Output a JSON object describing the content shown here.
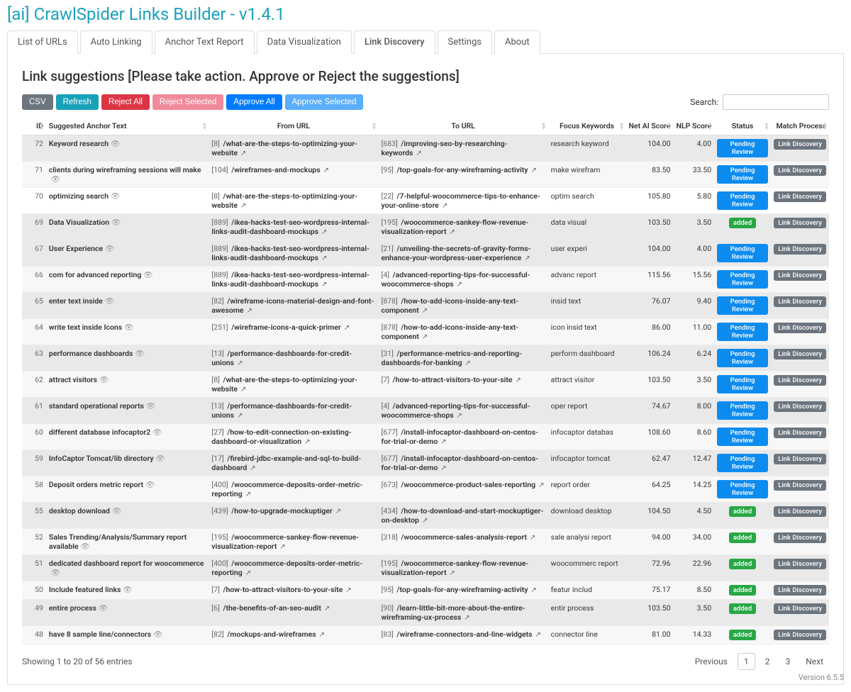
{
  "app": {
    "title": "[ai] CrawlSpider Links Builder - v1.4.1",
    "version": "Version 6.5.5"
  },
  "tabs": [
    {
      "label": "List of URLs"
    },
    {
      "label": "Auto Linking"
    },
    {
      "label": "Anchor Text Report"
    },
    {
      "label": "Data Visualization"
    },
    {
      "label": "Link Discovery"
    },
    {
      "label": "Settings"
    },
    {
      "label": "About"
    }
  ],
  "active_tab": 4,
  "section": {
    "title": "Link suggestions [Please take action. Approve or Reject the suggestions]"
  },
  "actions": {
    "csv": "CSV",
    "refresh": "Refresh",
    "reject_all": "Reject All",
    "reject_selected": "Reject Selected",
    "approve_all": "Approve All",
    "approve_selected": "Approve Selected"
  },
  "search": {
    "label": "Search:",
    "value": ""
  },
  "columns": {
    "id": "ID",
    "anchor": "Suggested Anchor Text",
    "from": "From URL",
    "to": "To URL",
    "focus": "Focus Keywords",
    "net": "Net AI Score",
    "nlp": "NLP Score",
    "status": "Status",
    "match": "Match Process"
  },
  "status_labels": {
    "pending": "Pending Review",
    "added": "added"
  },
  "match_label": "Link Discovery",
  "rows": [
    {
      "id": "72",
      "anchor": "Keyword research",
      "from_n": "[8]",
      "from_p": "/what-are-the-steps-to-optimizing-your-website",
      "to_n": "[683]",
      "to_p": "/improving-seo-by-researching-keywords",
      "kw": "research keyword",
      "net": "104.00",
      "nlp": "4.00",
      "status": "pending",
      "hl": true
    },
    {
      "id": "71",
      "anchor": "clients during wireframing sessions will make",
      "from_n": "[104]",
      "from_p": "/wireframes-and-mockups",
      "to_n": "[95]",
      "to_p": "/top-goals-for-any-wireframing-activity",
      "kw": "make wirefram",
      "net": "83.50",
      "nlp": "33.50",
      "status": "pending"
    },
    {
      "id": "70",
      "anchor": "optimizing search",
      "from_n": "[8]",
      "from_p": "/what-are-the-steps-to-optimizing-your-website",
      "to_n": "[22]",
      "to_p": "/7-helpful-woocommerce-tips-to-enhance-your-online-store",
      "kw": "optim search",
      "net": "105.80",
      "nlp": "5.80",
      "status": "pending"
    },
    {
      "id": "69",
      "anchor": "Data Visualization",
      "from_n": "[889]",
      "from_p": "/ikea-hacks-test-seo-wordpress-internal-links-audit-dashboard-mockups",
      "to_n": "[195]",
      "to_p": "/woocommerce-sankey-flow-revenue-visualization-report",
      "kw": "data visual",
      "net": "103.50",
      "nlp": "3.50",
      "status": "added",
      "hl": true
    },
    {
      "id": "67",
      "anchor": "User Experience",
      "from_n": "[889]",
      "from_p": "/ikea-hacks-test-seo-wordpress-internal-links-audit-dashboard-mockups",
      "to_n": "[21]",
      "to_p": "/unveiling-the-secrets-of-gravity-forms-enhance-your-wordpress-user-experience",
      "kw": "user experi",
      "net": "104.00",
      "nlp": "4.00",
      "status": "pending",
      "hl": true
    },
    {
      "id": "66",
      "anchor": "com for advanced reporting",
      "from_n": "[889]",
      "from_p": "/ikea-hacks-test-seo-wordpress-internal-links-audit-dashboard-mockups",
      "to_n": "[4]",
      "to_p": "/advanced-reporting-tips-for-successful-woocommerce-shops",
      "kw": "advanc report",
      "net": "115.56",
      "nlp": "15.56",
      "status": "pending"
    },
    {
      "id": "65",
      "anchor": "enter text inside",
      "from_n": "[82]",
      "from_p": "/wireframe-icons-material-design-and-font-awesome",
      "to_n": "[878]",
      "to_p": "/how-to-add-icons-inside-any-text-component",
      "kw": "insid text",
      "net": "76.07",
      "nlp": "9.40",
      "status": "pending",
      "hl": true
    },
    {
      "id": "64",
      "anchor": "write text inside Icons",
      "from_n": "[251]",
      "from_p": "/wireframe-icons-a-quick-primer",
      "to_n": "[878]",
      "to_p": "/how-to-add-icons-inside-any-text-component",
      "kw": "icon insid text",
      "net": "86.00",
      "nlp": "11.00",
      "status": "pending"
    },
    {
      "id": "63",
      "anchor": "performance dashboards",
      "from_n": "[13]",
      "from_p": "/performance-dashboards-for-credit-unions",
      "to_n": "[31]",
      "to_p": "/performance-metrics-and-reporting-dashboards-for-banking",
      "kw": "perform dashboard",
      "net": "106.24",
      "nlp": "6.24",
      "status": "pending",
      "hl": true
    },
    {
      "id": "62",
      "anchor": "attract visitors",
      "from_n": "[8]",
      "from_p": "/what-are-the-steps-to-optimizing-your-website",
      "to_n": "[7]",
      "to_p": "/how-to-attract-visitors-to-your-site",
      "kw": "attract visitor",
      "net": "103.50",
      "nlp": "3.50",
      "status": "pending"
    },
    {
      "id": "61",
      "anchor": "standard operational reports",
      "from_n": "[13]",
      "from_p": "/performance-dashboards-for-credit-unions",
      "to_n": "[4]",
      "to_p": "/advanced-reporting-tips-for-successful-woocommerce-shops",
      "kw": "oper report",
      "net": "74.67",
      "nlp": "8.00",
      "status": "pending",
      "hl": true
    },
    {
      "id": "60",
      "anchor": "different database infocaptor2",
      "from_n": "[27]",
      "from_p": "/how-to-edit-connection-on-existing-dashboard-or-visualization",
      "to_n": "[677]",
      "to_p": "/install-infocaptor-dashboard-on-centos-for-trial-or-demo",
      "kw": "infocaptor databas",
      "net": "108.60",
      "nlp": "8.60",
      "status": "pending"
    },
    {
      "id": "59",
      "anchor": "InfoCaptor Tomcat/lib directory",
      "from_n": "[17]",
      "from_p": "/firebird-jdbc-example-and-sql-to-build-dashboard",
      "to_n": "[677]",
      "to_p": "/install-infocaptor-dashboard-on-centos-for-trial-or-demo",
      "kw": "infocaptor tomcat",
      "net": "62.47",
      "nlp": "12.47",
      "status": "pending",
      "hl": true
    },
    {
      "id": "58",
      "anchor": "Deposit orders metric report",
      "from_n": "[400]",
      "from_p": "/woocommerce-deposits-order-metric-reporting",
      "to_n": "[673]",
      "to_p": "/woocommerce-product-sales-reporting",
      "kw": "report order",
      "net": "64.25",
      "nlp": "14.25",
      "status": "pending"
    },
    {
      "id": "55",
      "anchor": "desktop download",
      "from_n": "[439]",
      "from_p": "/how-to-upgrade-mockuptiger",
      "to_n": "[434]",
      "to_p": "/how-to-download-and-start-mockuptiger-on-desktop",
      "kw": "download desktop",
      "net": "104.50",
      "nlp": "4.50",
      "status": "added",
      "hl": true
    },
    {
      "id": "52",
      "anchor": "Sales Trending/Analysis/Summary report available",
      "from_n": "[195]",
      "from_p": "/woocommerce-sankey-flow-revenue-visualization-report",
      "to_n": "[318]",
      "to_p": "/woocommerce-sales-analysis-report",
      "kw": "sale analysi report",
      "net": "94.00",
      "nlp": "34.00",
      "status": "added"
    },
    {
      "id": "51",
      "anchor": "dedicated dashboard report for woocommerce",
      "from_n": "[400]",
      "from_p": "/woocommerce-deposits-order-metric-reporting",
      "to_n": "[195]",
      "to_p": "/woocommerce-sankey-flow-revenue-visualization-report",
      "kw": "woocommerc report",
      "net": "72.96",
      "nlp": "22.96",
      "status": "added",
      "hl": true
    },
    {
      "id": "50",
      "anchor": "Include featured links",
      "from_n": "[7]",
      "from_p": "/how-to-attract-visitors-to-your-site",
      "to_n": "[95]",
      "to_p": "/top-goals-for-any-wireframing-activity",
      "kw": "featur includ",
      "net": "75.17",
      "nlp": "8.50",
      "status": "added"
    },
    {
      "id": "49",
      "anchor": "entire process",
      "from_n": "[6]",
      "from_p": "/the-benefits-of-an-seo-audit",
      "to_n": "[90]",
      "to_p": "/learn-little-bit-more-about-the-entire-wireframing-ux-process",
      "kw": "entir process",
      "net": "103.50",
      "nlp": "3.50",
      "status": "added",
      "hl": true
    },
    {
      "id": "48",
      "anchor": "have 8 sample line/connectors",
      "from_n": "[82]",
      "from_p": "/mockups-and-wireframes",
      "to_n": "[83]",
      "to_p": "/wireframe-connectors-and-line-widgets",
      "kw": "connector line",
      "net": "81.00",
      "nlp": "14.33",
      "status": "added"
    }
  ],
  "footer": {
    "showing": "Showing 1 to 20 of 56 entries",
    "prev": "Previous",
    "next": "Next",
    "pages": [
      "1",
      "2",
      "3"
    ]
  }
}
